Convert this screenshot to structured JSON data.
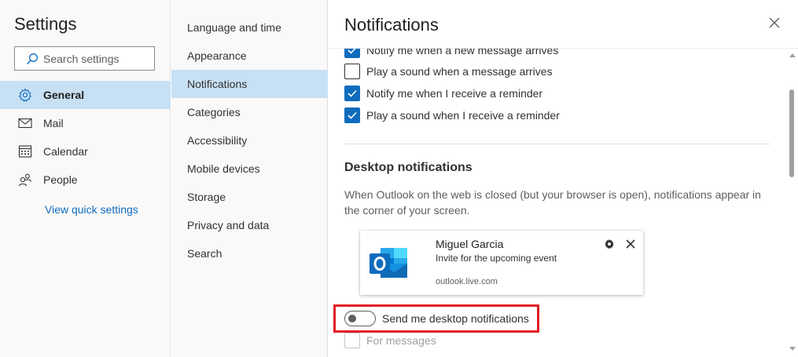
{
  "left_pane": {
    "title": "Settings",
    "search": {
      "placeholder": "Search settings",
      "value": ""
    },
    "nav": [
      {
        "label": "General",
        "icon": "gear-icon",
        "selected": true
      },
      {
        "label": "Mail",
        "icon": "mail-icon",
        "selected": false
      },
      {
        "label": "Calendar",
        "icon": "calendar-icon",
        "selected": false
      },
      {
        "label": "People",
        "icon": "people-icon",
        "selected": false
      }
    ],
    "quick_settings_link": "View quick settings"
  },
  "middle_pane": {
    "items": [
      {
        "label": "Language and time",
        "selected": false
      },
      {
        "label": "Appearance",
        "selected": false
      },
      {
        "label": "Notifications",
        "selected": true
      },
      {
        "label": "Categories",
        "selected": false
      },
      {
        "label": "Accessibility",
        "selected": false
      },
      {
        "label": "Mobile devices",
        "selected": false
      },
      {
        "label": "Storage",
        "selected": false
      },
      {
        "label": "Privacy and data",
        "selected": false
      },
      {
        "label": "Search",
        "selected": false
      }
    ]
  },
  "right_pane": {
    "title": "Notifications",
    "checkboxes": [
      {
        "label": "Notify me when a new message arrives",
        "checked": true
      },
      {
        "label": "Play a sound when a message arrives",
        "checked": false
      },
      {
        "label": "Notify me when I receive a reminder",
        "checked": true
      },
      {
        "label": "Play a sound when I receive a reminder",
        "checked": true
      }
    ],
    "desktop": {
      "title": "Desktop notifications",
      "description": "When Outlook on the web is closed (but your browser is open), notifications appear in the corner of your screen.",
      "preview": {
        "sender": "Miguel Garcia",
        "subject": "Invite for the upcoming event",
        "domain": "outlook.live.com"
      },
      "toggle": {
        "label": "Send me desktop notifications",
        "on": false
      },
      "for_messages": {
        "label": "For messages",
        "checked": false,
        "disabled": true
      }
    }
  },
  "colors": {
    "accent": "#0f6cbd",
    "selected_bg": "#c7e0f4",
    "highlight_border": "#e01e25"
  }
}
